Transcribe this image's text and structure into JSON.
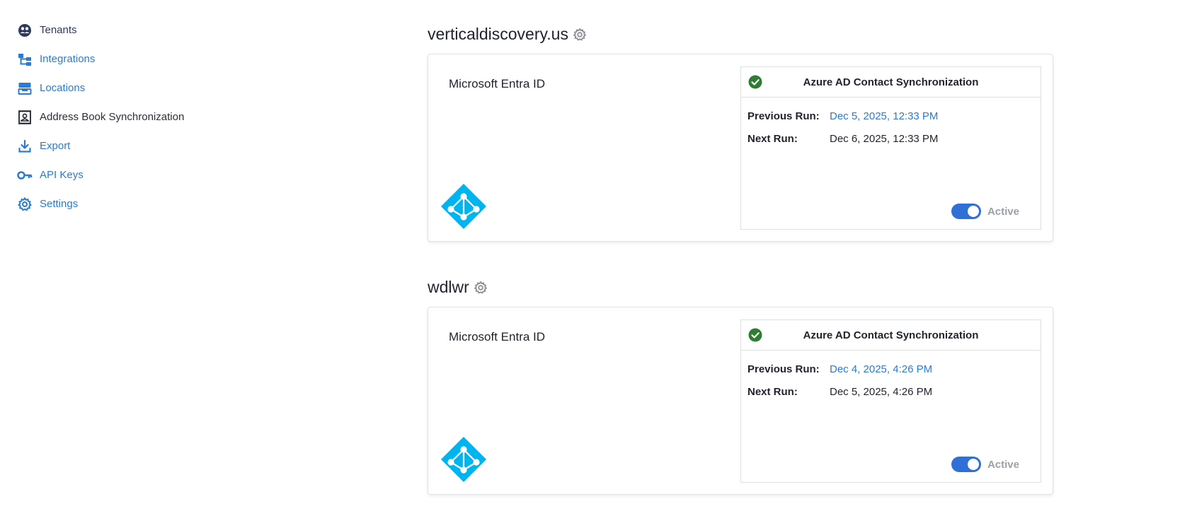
{
  "sidebar": {
    "items": [
      {
        "label": "Tenants",
        "icon": "tenants-icon"
      },
      {
        "label": "Integrations",
        "icon": "integrations-icon"
      },
      {
        "label": "Locations",
        "icon": "locations-icon"
      },
      {
        "label": "Address Book Synchronization",
        "icon": "address-book-icon"
      },
      {
        "label": "Export",
        "icon": "export-icon"
      },
      {
        "label": "API Keys",
        "icon": "key-icon"
      },
      {
        "label": "Settings",
        "icon": "gear-icon"
      }
    ]
  },
  "tenants": [
    {
      "name": "verticaldiscovery.us",
      "provider": "Microsoft Entra ID",
      "sync": {
        "title": "Azure AD Contact Synchronization",
        "previous_label": "Previous Run:",
        "previous_value": "Dec 5, 2025, 12:33 PM",
        "next_label": "Next Run:",
        "next_value": "Dec 6, 2025, 12:33 PM",
        "status_label": "Active"
      }
    },
    {
      "name": "wdlwr",
      "provider": "Microsoft Entra ID",
      "sync": {
        "title": "Azure AD Contact Synchronization",
        "previous_label": "Previous Run:",
        "previous_value": "Dec 4, 2025, 4:26 PM",
        "next_label": "Next Run:",
        "next_value": "Dec 5, 2025, 4:26 PM",
        "status_label": "Active"
      }
    }
  ],
  "colors": {
    "link": "#2a7bd1",
    "toggle_on": "#2f6fd6",
    "success": "#2e7d32",
    "entra_blue": "#00b4f0"
  }
}
